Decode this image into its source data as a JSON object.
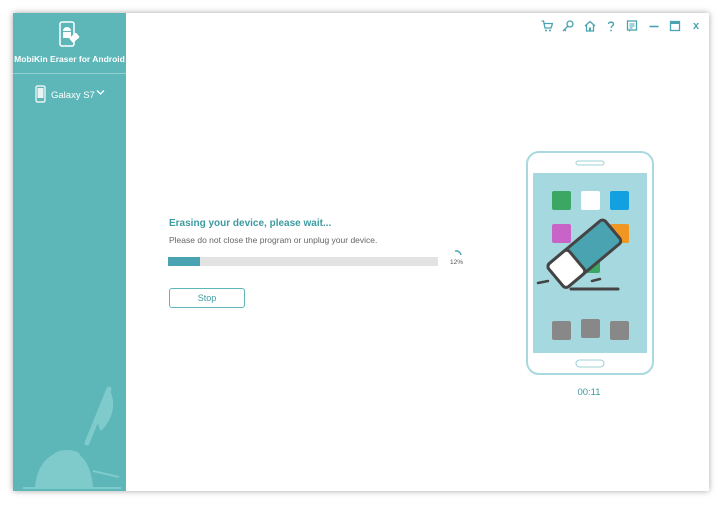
{
  "app": {
    "name": "MobiKin Eraser for Android",
    "device_name": "Galaxy S7"
  },
  "titlebar": {
    "icons": [
      "cart-icon",
      "key-icon",
      "home-icon",
      "help-icon",
      "feedback-icon",
      "minimize-icon",
      "maximize-icon",
      "close-icon"
    ],
    "close_label": "x"
  },
  "erase": {
    "title": "Erasing your device, please wait...",
    "subtitle": "Please do not close the program or unplug your device.",
    "progress_percent": 12,
    "progress_label": "12%",
    "stop_label": "Stop",
    "timer": "00:11"
  },
  "colors": {
    "sidebar": "#5db6b8",
    "accent": "#3c9ba1",
    "progress": "#4aa3b0"
  }
}
